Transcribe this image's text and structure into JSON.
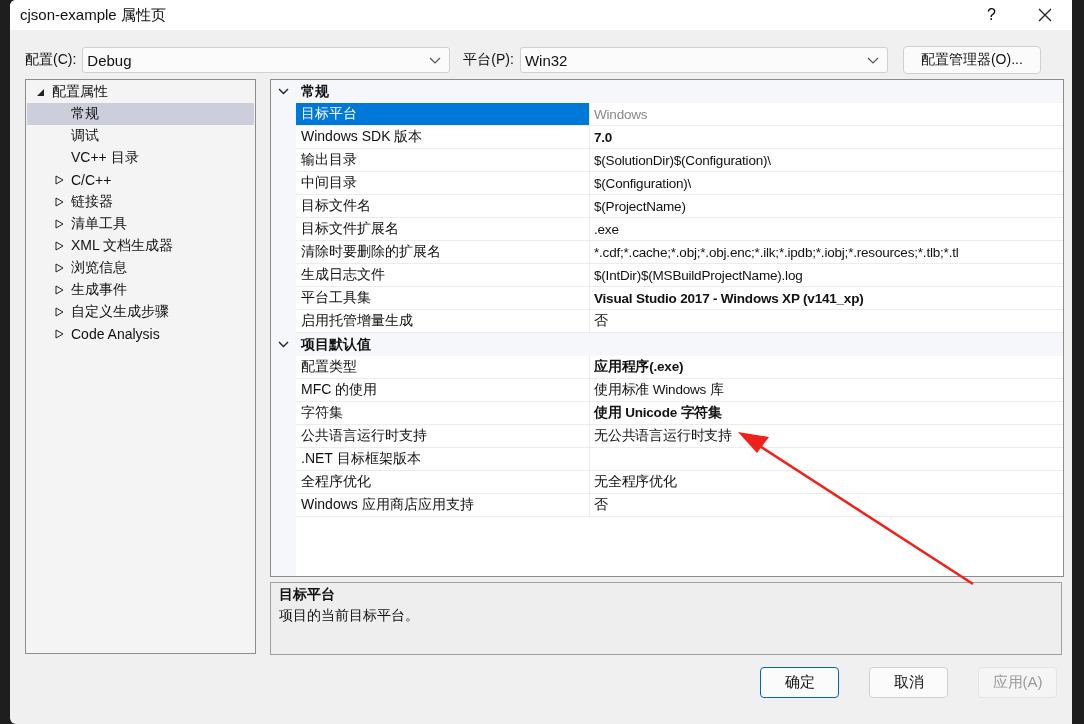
{
  "window": {
    "title": "cjson-example 属性页"
  },
  "title_buttons": [
    "?"
  ],
  "config": {
    "label": "配置(C):",
    "value": "Debug"
  },
  "platform": {
    "label": "平台(P):",
    "value": "Win32"
  },
  "config_manager_button": "配置管理器(O)...",
  "tree": [
    {
      "label": "配置属性",
      "kind": "group",
      "expanded": true,
      "selected": false,
      "children": [
        {
          "label": "常规",
          "kind": "leaf",
          "selected": true
        },
        {
          "label": "调试",
          "kind": "leaf",
          "selected": false
        },
        {
          "label": "VC++ 目录",
          "kind": "leaf",
          "selected": false
        },
        {
          "label": "C/C++",
          "kind": "group",
          "expanded": false,
          "selected": false
        },
        {
          "label": "链接器",
          "kind": "group",
          "expanded": false,
          "selected": false
        },
        {
          "label": "清单工具",
          "kind": "group",
          "expanded": false,
          "selected": false
        },
        {
          "label": "XML 文档生成器",
          "kind": "group",
          "expanded": false,
          "selected": false
        },
        {
          "label": "浏览信息",
          "kind": "group",
          "expanded": false,
          "selected": false
        },
        {
          "label": "生成事件",
          "kind": "group",
          "expanded": false,
          "selected": false
        },
        {
          "label": "自定义生成步骤",
          "kind": "group",
          "expanded": false,
          "selected": false
        },
        {
          "label": "Code Analysis",
          "kind": "group",
          "expanded": false,
          "selected": false
        }
      ]
    }
  ],
  "properties": [
    {
      "category": "常规",
      "expanded": true,
      "rows": [
        {
          "name": "目标平台",
          "value": "Windows",
          "selected": true,
          "bold": false,
          "dimmed": true
        },
        {
          "name": "Windows SDK 版本",
          "value": "7.0",
          "selected": false,
          "bold": true,
          "dimmed": false
        },
        {
          "name": "输出目录",
          "value": "$(SolutionDir)$(Configuration)\\",
          "selected": false,
          "bold": false,
          "dimmed": false
        },
        {
          "name": "中间目录",
          "value": "$(Configuration)\\",
          "selected": false,
          "bold": false,
          "dimmed": false
        },
        {
          "name": "目标文件名",
          "value": "$(ProjectName)",
          "selected": false,
          "bold": false,
          "dimmed": false
        },
        {
          "name": "目标文件扩展名",
          "value": ".exe",
          "selected": false,
          "bold": false,
          "dimmed": false
        },
        {
          "name": "清除时要删除的扩展名",
          "value": "*.cdf;*.cache;*.obj;*.obj.enc;*.ilk;*.ipdb;*.iobj;*.resources;*.tlb;*.tl",
          "selected": false,
          "bold": false,
          "dimmed": false
        },
        {
          "name": "生成日志文件",
          "value": "$(IntDir)$(MSBuildProjectName).log",
          "selected": false,
          "bold": false,
          "dimmed": false
        },
        {
          "name": "平台工具集",
          "value": "Visual Studio 2017 - Windows XP (v141_xp)",
          "selected": false,
          "bold": true,
          "dimmed": false
        },
        {
          "name": "启用托管增量生成",
          "value": "否",
          "selected": false,
          "bold": false,
          "dimmed": false
        }
      ]
    },
    {
      "category": "项目默认值",
      "expanded": true,
      "rows": [
        {
          "name": "配置类型",
          "value": "应用程序(.exe)",
          "selected": false,
          "bold": true,
          "dimmed": false
        },
        {
          "name": "MFC 的使用",
          "value": "使用标准 Windows 库",
          "selected": false,
          "bold": false,
          "dimmed": false
        },
        {
          "name": "字符集",
          "value": "使用 Unicode 字符集",
          "selected": false,
          "bold": true,
          "dimmed": false
        },
        {
          "name": "公共语言运行时支持",
          "value": "无公共语言运行时支持",
          "selected": false,
          "bold": false,
          "dimmed": false
        },
        {
          "name": ".NET 目标框架版本",
          "selected": false
        },
        {
          "name": "全程序优化",
          "value": "无全程序优化",
          "selected": false,
          "bold": false,
          "dimmed": false
        },
        {
          "name": "Windows 应用商店应用支持",
          "value": "否",
          "selected": false,
          "bold": false,
          "dimmed": false
        }
      ]
    }
  ],
  "description": {
    "title": "目标平台",
    "text": "项目的当前目标平台。"
  },
  "buttons": [
    {
      "label": "确定",
      "default": true,
      "disabled": false
    },
    {
      "label": "取消",
      "default": false,
      "disabled": false
    },
    {
      "label": "应用(A)",
      "default": false,
      "disabled": true
    }
  ]
}
